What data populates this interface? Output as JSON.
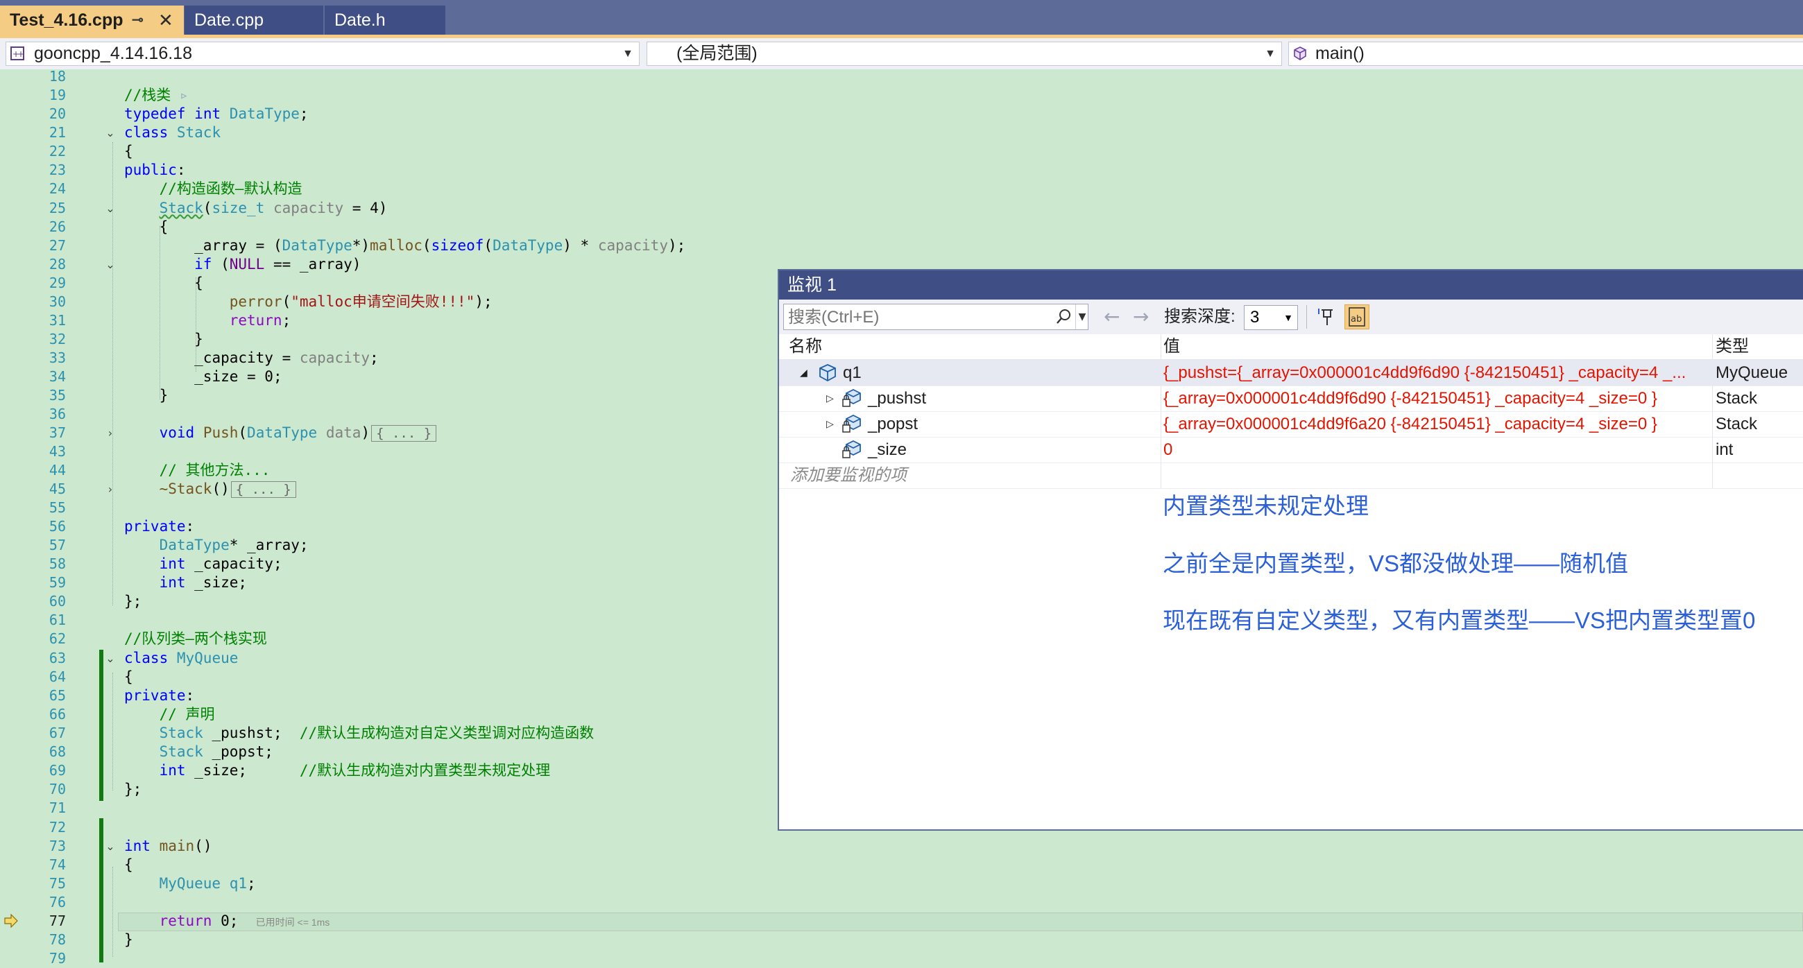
{
  "tabs": [
    {
      "label": "Test_4.16.cpp",
      "pin": "⊸",
      "close": "✕"
    },
    {
      "label": "Date.cpp"
    },
    {
      "label": "Date.h"
    }
  ],
  "navbar": {
    "project": "gooncpp_4.14.16.18",
    "scope": "(全局范围)",
    "member": "main()"
  },
  "code_lines": [
    {
      "n": "18"
    },
    {
      "n": "19"
    },
    {
      "n": "20"
    },
    {
      "n": "21"
    },
    {
      "n": "22"
    },
    {
      "n": "23"
    },
    {
      "n": "24"
    },
    {
      "n": "25"
    },
    {
      "n": "26"
    },
    {
      "n": "27"
    },
    {
      "n": "28"
    },
    {
      "n": "29"
    },
    {
      "n": "30"
    },
    {
      "n": "31"
    },
    {
      "n": "32"
    },
    {
      "n": "33"
    },
    {
      "n": "34"
    },
    {
      "n": "35"
    },
    {
      "n": "36"
    },
    {
      "n": "37"
    },
    {
      "n": "43"
    },
    {
      "n": "44"
    },
    {
      "n": "45"
    },
    {
      "n": "55"
    },
    {
      "n": "56"
    },
    {
      "n": "57"
    },
    {
      "n": "58"
    },
    {
      "n": "59"
    },
    {
      "n": "60"
    },
    {
      "n": "61"
    },
    {
      "n": "62"
    },
    {
      "n": "63"
    },
    {
      "n": "64"
    },
    {
      "n": "65"
    },
    {
      "n": "66"
    },
    {
      "n": "67"
    },
    {
      "n": "68"
    },
    {
      "n": "69"
    },
    {
      "n": "70"
    },
    {
      "n": "71"
    },
    {
      "n": "72"
    },
    {
      "n": "73"
    },
    {
      "n": "74"
    },
    {
      "n": "75"
    },
    {
      "n": "76"
    },
    {
      "n": "77"
    },
    {
      "n": "78"
    },
    {
      "n": "79"
    }
  ],
  "code": {
    "l19": "//栈类",
    "l20a": "typedef",
    "l20b": "int",
    "l20c": "DataType",
    "l21a": "class",
    "l21b": "Stack",
    "l23": "public",
    "l24": "//构造函数—默认构造",
    "l25a": "Stack",
    "l25b": "size_t",
    "l25c": "capacity",
    "l25d": "4",
    "l27a": "_array = (",
    "l27b": "DataType",
    "l27c": "*)",
    "l27d": "malloc",
    "l27e": "sizeof",
    "l27f": "DataType",
    "l27g": "capacity",
    "l28a": "if",
    "l28b": "NULL",
    "l28c": "_array",
    "l30a": "perror",
    "l30b": "\"malloc申请空间失败!!!\"",
    "l31": "return",
    "l33a": "_capacity = ",
    "l33b": "capacity",
    "l34": "_size = 0;",
    "l37a": "void",
    "l37b": "Push",
    "l37c": "DataType",
    "l37d": "data",
    "l37e": "{ ... }",
    "l44": "// 其他方法...",
    "l45a": "~Stack",
    "l45b": "{ ... }",
    "l56": "private",
    "l57a": "DataType",
    "l57b": "* _array;",
    "l58a": "int",
    "l58b": " _capacity;",
    "l59a": "int",
    "l59b": " _size;",
    "l62": "//队列类—两个栈实现",
    "l63a": "class",
    "l63b": "MyQueue",
    "l65": "private",
    "l66": "// 声明",
    "l67a": "Stack",
    "l67b": " _pushst;  ",
    "l67c": "//默认生成构造对自定义类型调对应构造函数",
    "l68a": "Stack",
    "l68b": " _popst;",
    "l69a": "int",
    "l69b": " _size;      ",
    "l69c": "//默认生成构造对内置类型未规定处理",
    "l73a": "int",
    "l73b": "main",
    "l75a": "MyQueue",
    "l75b": "q1",
    "l77a": "return",
    "l77b": " 0;",
    "elapsed": "已用时间 <= 1ms"
  },
  "watch": {
    "title": "监视 1",
    "search_placeholder": "搜索(Ctrl+E)",
    "back_arrow": "←",
    "forward_arrow": "→",
    "depth_label": "搜索深度:",
    "depth_value": "3",
    "columns": {
      "name": "名称",
      "value": "值",
      "type": "类型"
    },
    "rows": [
      {
        "name": "q1",
        "value": "{_pushst={_array=0x000001c4dd9f6d90 {-842150451} _capacity=4 _...",
        "type": "MyQueue"
      },
      {
        "name": "_pushst",
        "value": "{_array=0x000001c4dd9f6d90 {-842150451} _capacity=4 _size=0 }",
        "type": "Stack"
      },
      {
        "name": "_popst",
        "value": "{_array=0x000001c4dd9f6a20 {-842150451} _capacity=4 _size=0 }",
        "type": "Stack"
      },
      {
        "name": "_size",
        "value": "0",
        "type": "int"
      }
    ],
    "add_item_hint": "添加要监视的项"
  },
  "annotations": [
    "内置类型未规定处理",
    "之前全是内置类型，VS都没做处理——随机值",
    "现在既有自定义类型，又有内置类型——VS把内置类型置0"
  ],
  "colors": {
    "editor_bg": "#cce8cf",
    "tab_active": "#f5cc84",
    "tab_bar": "#5d6b98",
    "value_changed": "#e51400",
    "annotation": "#2a5fd8"
  }
}
